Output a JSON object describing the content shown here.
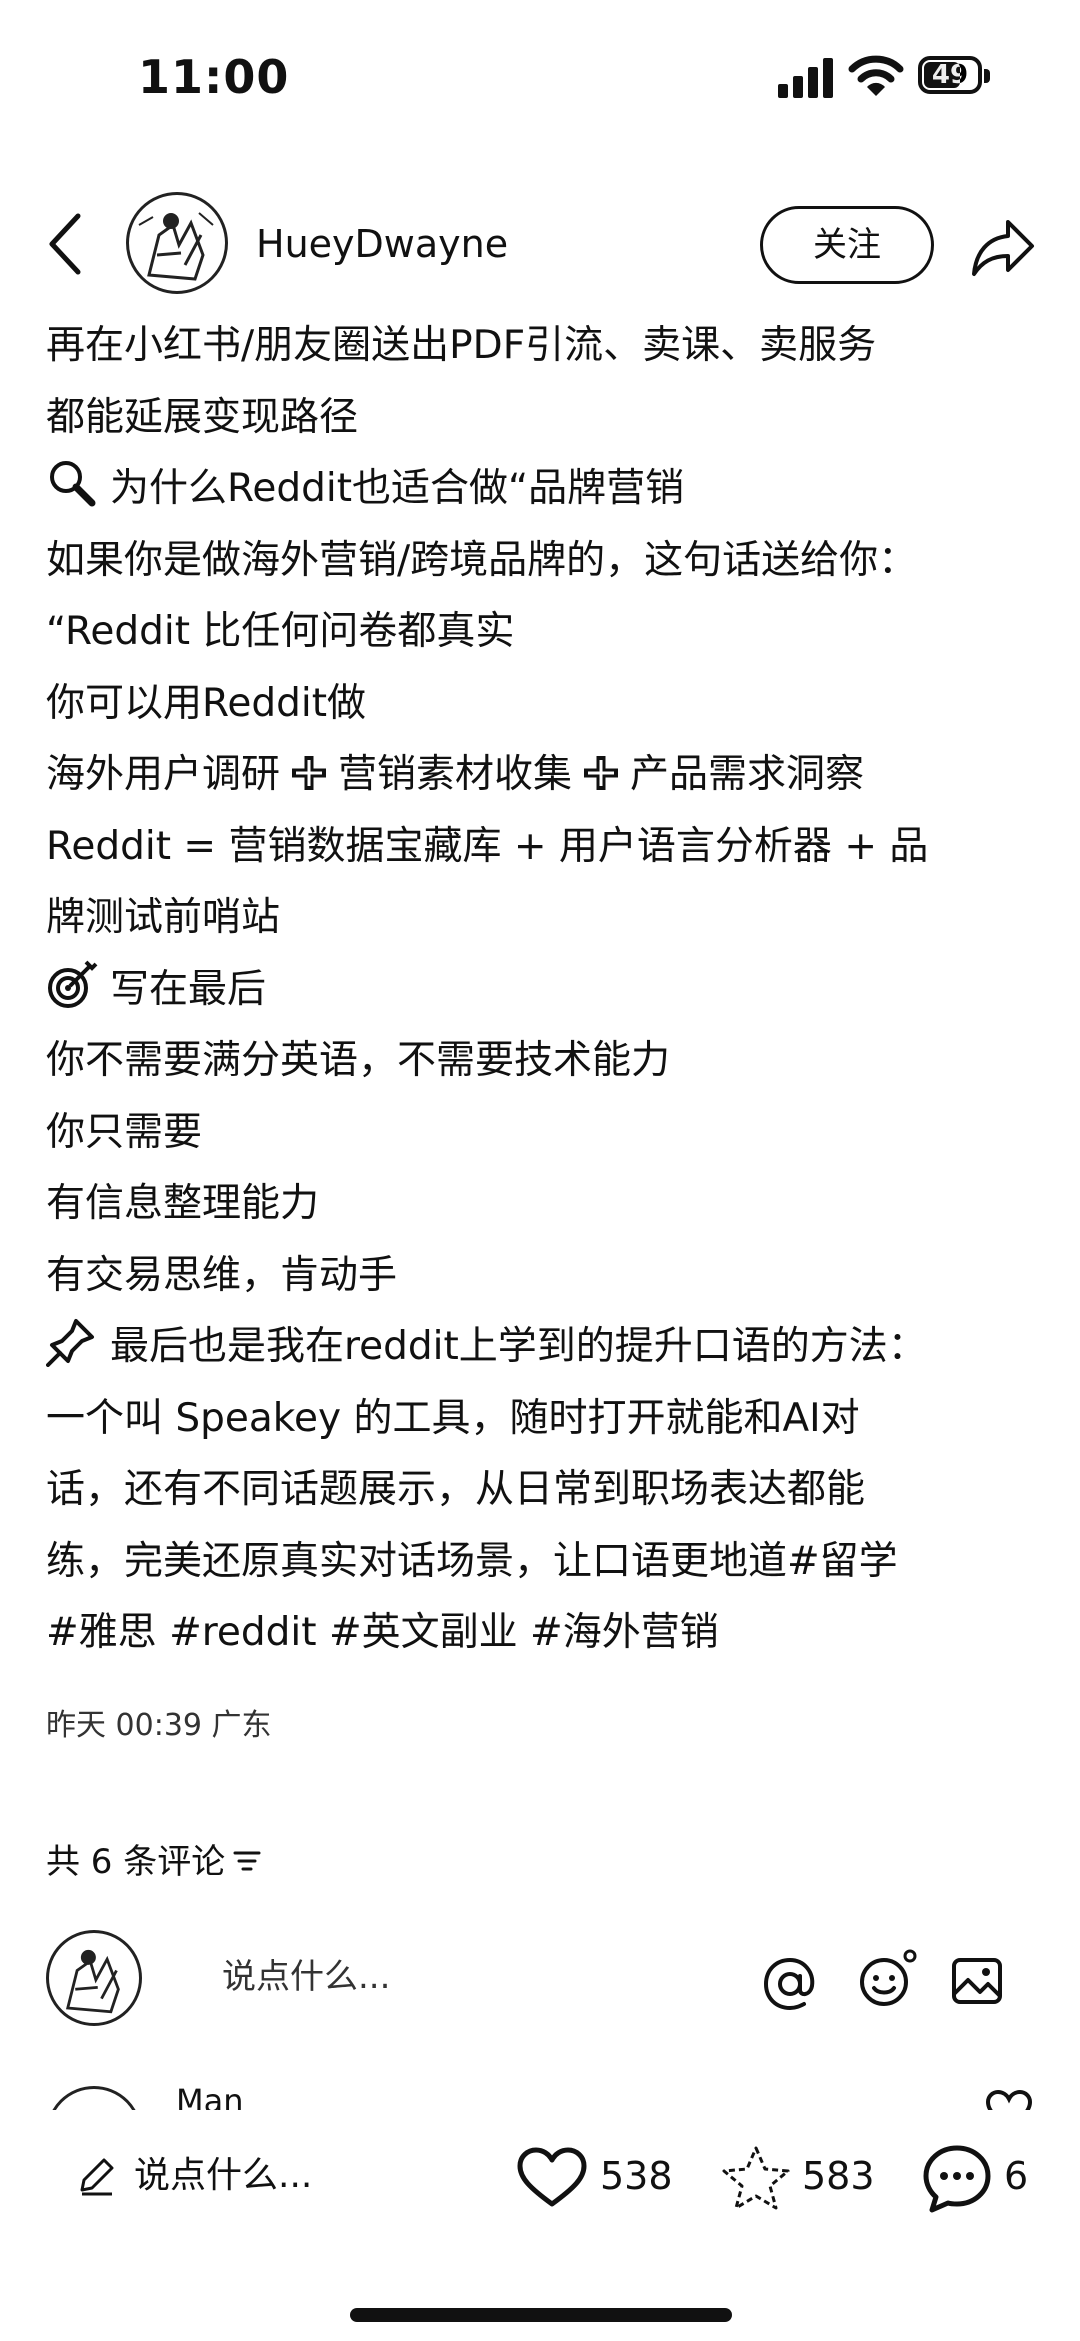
{
  "status_bar": {
    "time": "11:00",
    "battery": "49"
  },
  "header": {
    "username": "HueyDwayne",
    "follow_label": "关注"
  },
  "post": {
    "lines": [
      "再在小红书/朋友圈送出PDF引流、卖课、卖服务",
      "都能延展变现路径",
      "为什么Reddit也适合做“品牌营销",
      "如果你是做海外营销/跨境品牌的，这句话送给你：",
      "“Reddit 比任何问卷都真实",
      "你可以用Reddit做",
      "海外用户调研",
      "营销素材收集",
      "产品需求洞察",
      "Reddit = 营销数据宝藏库 + 用户语言分析器 + 品",
      "牌测试前哨站",
      "写在最后",
      "你不需要满分英语，不需要技术能力",
      "你只需要",
      "有信息整理能力",
      "有交易思维，肯动手",
      "最后也是我在reddit上学到的提升口语的方法：",
      "一个叫 Speakey 的工具，随时打开就能和AI对",
      "话，还有不同话题展示，从日常到职场表达都能",
      "练，完美还原真实对话场景，让口语更地道#留学",
      "#雅思 #reddit #英文副业 #海外营销"
    ],
    "meta": "昨天 00:39 广东"
  },
  "comments": {
    "count_label": "共 6 条评论",
    "input_placeholder": "说点什么...",
    "next_name": "Man"
  },
  "bottom_bar": {
    "input_label": "说点什么...",
    "likes": "538",
    "stars": "583",
    "comments": "6"
  },
  "colors": {
    "text": "#111111",
    "background": "#ffffff",
    "muted": "#333333"
  }
}
